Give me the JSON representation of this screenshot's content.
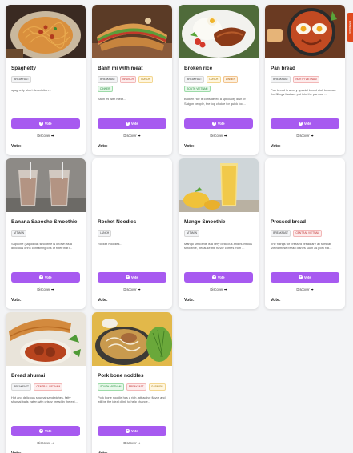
{
  "feedback_label": "Feedback",
  "card_labels": {
    "vote": "Vote",
    "discover": "Discover",
    "votes_prefix": "Vote:"
  },
  "dishes": [
    {
      "title": "Spaghetty",
      "tags": [
        "BREAKFAST"
      ],
      "desc": "spaghetty short description..."
    },
    {
      "title": "Banh mi with meat",
      "tags": [
        "BREAKFAST",
        "BRUNCH",
        "LUNCH",
        "DINNER"
      ],
      "desc": "Banh mi with meat..."
    },
    {
      "title": "Broken rice",
      "tags": [
        "BREAKFAST",
        "LUNCH",
        "DINNER",
        "SOUTH VIETNAM"
      ],
      "desc": "Broken rice is considered a speciality dish of Saigon people, the top choice for quick foo..."
    },
    {
      "title": "Pan bread",
      "tags": [
        "BREAKFAST",
        "NORTH VIETNAM"
      ],
      "desc": "Pan bread is a very special bread dish because the fillings that are put into the pan are ..."
    },
    {
      "title": "Banana Sapoche Smoothie",
      "tags": [
        "VITAMIN"
      ],
      "desc": "Sapoche (sapodilla) smoothie is known as a delicious drink containing lots of fiber that i..."
    },
    {
      "title": "Rocket Noodles",
      "tags": [
        "LUNCH"
      ],
      "desc": "Rocket Noodles..."
    },
    {
      "title": "Mango Smoothie",
      "tags": [
        "VITAMIN"
      ],
      "desc": "Mango smoothie is a very delicious and nutritious smoothie, because the flavor comes from ..."
    },
    {
      "title": "Pressed bread",
      "tags": [
        "BREAKFAST",
        "CENTRAL VIETNAM"
      ],
      "desc": "The fillings for pressed bread are all familiar Vietnamese bread dishes such as pork roll..."
    },
    {
      "title": "Bread shumai",
      "tags": [
        "BREAKFAST",
        "CENTRAL VIETNAM"
      ],
      "desc": "Hot and delicious shumai sandwiches, fatty shumai balls eaten with crispy bread in the ext..."
    },
    {
      "title": "Pork bone noddles",
      "tags": [
        "SOUTH VIETNAM",
        "BREAKFAST",
        "GARNISH"
      ],
      "desc": "Pork bone noodle has a rich, attractive flavor and will be the ideal drink to help change..."
    }
  ]
}
